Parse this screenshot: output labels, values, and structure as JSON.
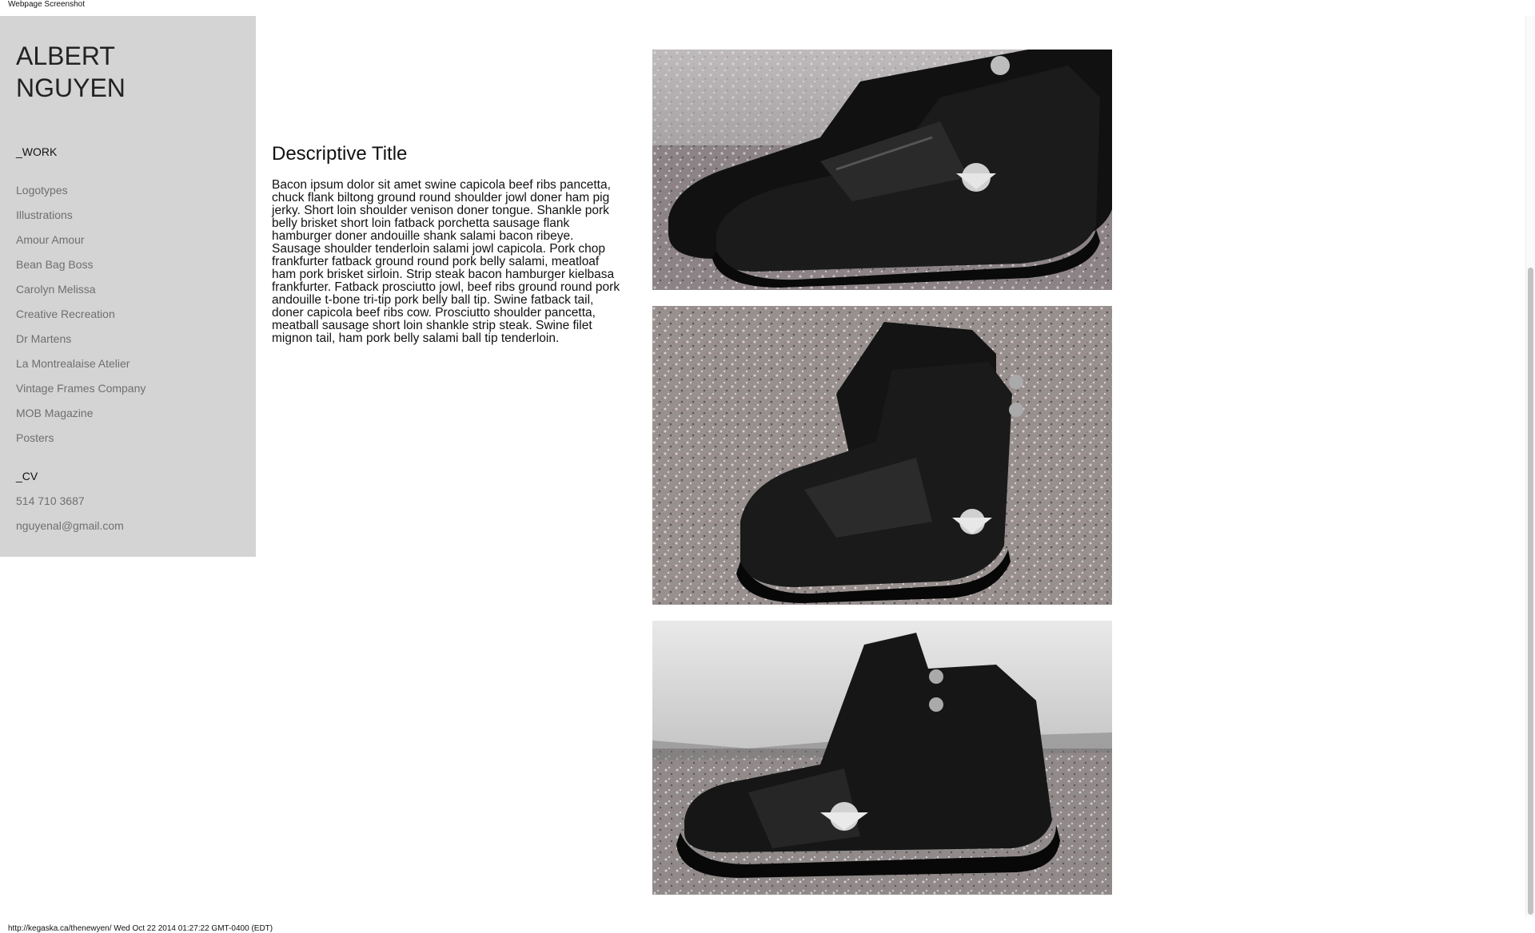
{
  "screenshot_label": "Webpage Screenshot",
  "footer_url": "http://kegaska.ca/thenewyen/ Wed Oct 22 2014 01:27:22 GMT-0400 (EDT)",
  "sidebar": {
    "brand_line1": "ALBERT",
    "brand_line2": "NGUYEN",
    "work_heading": "_WORK",
    "work_items": [
      "Logotypes",
      "Illustrations",
      "Amour Amour",
      "Bean Bag Boss",
      "Carolyn Melissa",
      "Creative Recreation",
      "Dr Martens",
      "La Montrealaise Atelier",
      "Vintage Frames Company",
      "MOB Magazine",
      "Posters"
    ],
    "cv_heading": "_CV",
    "phone": "514 710 3687",
    "email": "nguyenal@gmail.com"
  },
  "article": {
    "title": "Descriptive Title",
    "body": "Bacon ipsum dolor sit amet swine capicola beef ribs pancetta, chuck flank biltong ground round shoulder jowl doner ham pig jerky. Short loin shoulder venison doner tongue. Shankle pork belly brisket short loin fatback porchetta sausage flank hamburger doner andouille shank salami bacon ribeye. Sausage shoulder tenderloin salami jowl capicola. Pork chop frankfurter fatback ground round pork belly salami, meatloaf ham pork brisket sirloin. Strip steak bacon hamburger kielbasa frankfurter. Fatback prosciutto jowl, beef ribs ground round pork andouille t-bone tri-tip pork belly ball tip. Swine fatback tail, doner capicola beef ribs cow. Prosciutto shoulder pancetta, meatball sausage short loin shankle strip steak. Swine filet mignon tail, ham pork belly salami ball tip tenderloin."
  },
  "colors": {
    "sidebar_bg": "#d4d4d4",
    "nav_text": "#6f6f6f",
    "floor": "#8f8789",
    "shoe": "#151515"
  }
}
